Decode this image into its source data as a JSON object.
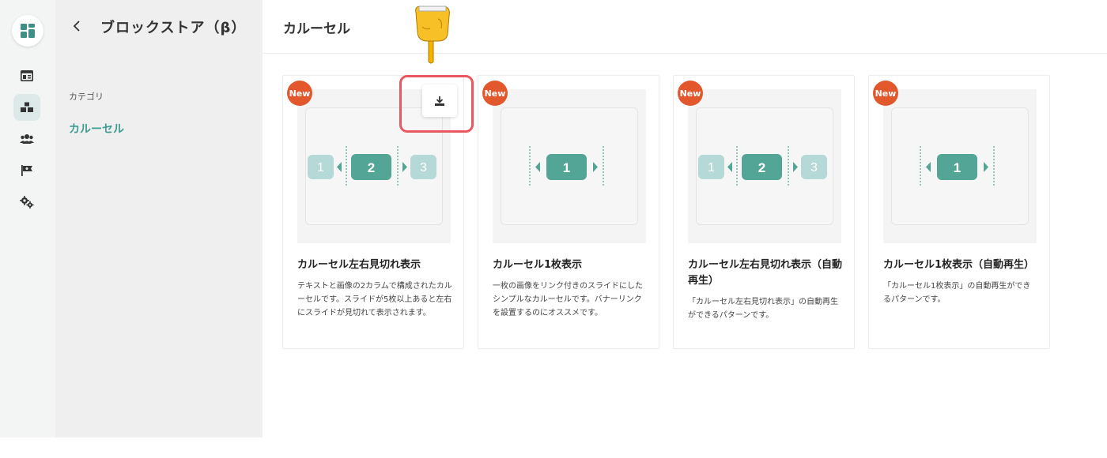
{
  "sidebar": {
    "back_icon": "chevron-left-icon",
    "title": "ブロックストア（β）",
    "category_label": "カテゴリ",
    "category_item": "カルーセル"
  },
  "rail": {
    "items": [
      "dashboard-icon",
      "blocks-icon",
      "users-icon",
      "flag-icon",
      "settings-icon"
    ],
    "active": "blocks-icon",
    "accent": "#3f9c93"
  },
  "main": {
    "title": "カルーセル"
  },
  "cards": [
    {
      "badge": "New",
      "title": "カルーセル左右見切れ表示",
      "description": "テキストと画像の2カラムで構成されたカルーセルです。スライドが5枚以上あると左右にスライドが見切れて表示されます。",
      "preview": [
        "1",
        "2",
        "3"
      ]
    },
    {
      "badge": "New",
      "title": "カルーセル1枚表示",
      "description": "一枚の画像をリンク付きのスライドにしたシンプルなカルーセルです。バナーリンクを設置するのにオススメです。",
      "preview": [
        "1"
      ]
    },
    {
      "badge": "New",
      "title": "カルーセル左右見切れ表示（自動再生）",
      "description": "「カルーセル左右見切れ表示」の自動再生ができるパターンです。",
      "preview": [
        "1",
        "2",
        "3"
      ]
    },
    {
      "badge": "New",
      "title": "カルーセル1枚表示（自動再生）",
      "description": "「カルーセル1枚表示」の自動再生ができるパターンです。",
      "preview": [
        "1"
      ]
    }
  ],
  "download_icon": "download-icon",
  "pointer_icon": "pointing-hand-icon",
  "colors": {
    "badge": "#e2582c",
    "slide_active": "#53a596",
    "slide_inactive": "#b4d9d6",
    "highlight": "#e8595f"
  }
}
